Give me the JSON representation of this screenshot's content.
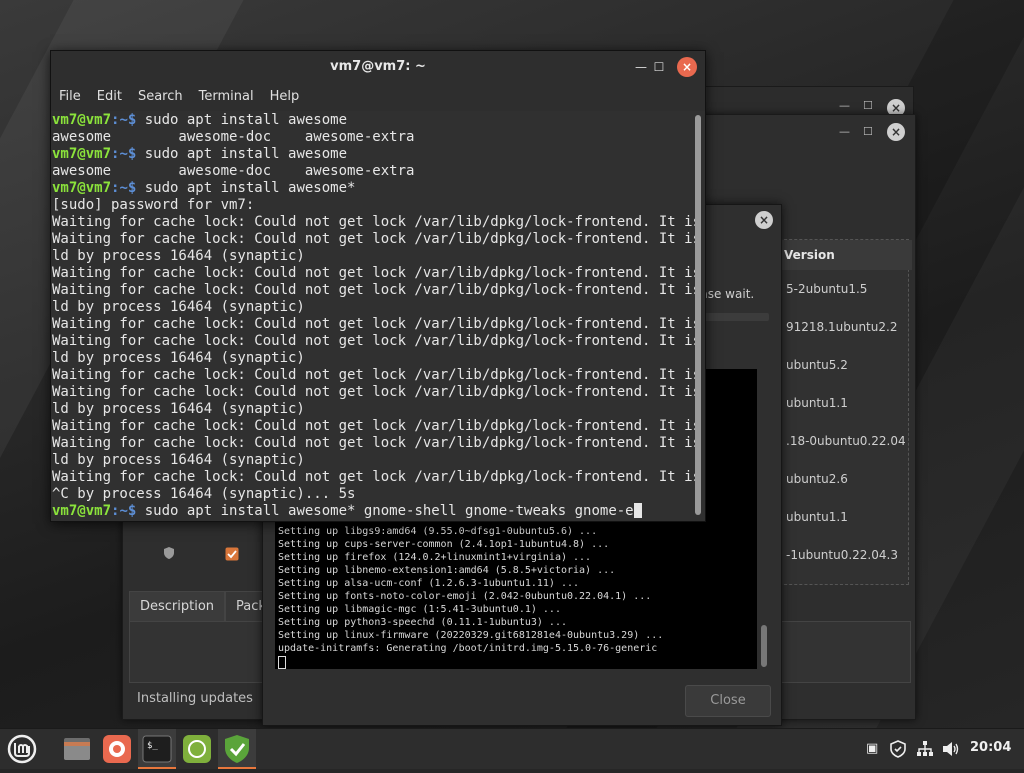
{
  "terminal": {
    "title": "vm7@vm7: ~",
    "menu": [
      "File",
      "Edit",
      "Search",
      "Terminal",
      "Help"
    ],
    "prompt_user": "vm7@vm7",
    "prompt_path": ":~$ ",
    "lines": [
      {
        "prompt": true,
        "text": "sudo apt install awesome"
      },
      {
        "prompt": false,
        "text": "awesome        awesome-doc    awesome-extra"
      },
      {
        "prompt": true,
        "text": "sudo apt install awesome"
      },
      {
        "prompt": false,
        "text": "awesome        awesome-doc    awesome-extra"
      },
      {
        "prompt": true,
        "text": "sudo apt install awesome*"
      },
      {
        "prompt": false,
        "text": "[sudo] password for vm7:"
      },
      {
        "prompt": false,
        "text": "Waiting for cache lock: Could not get lock /var/lib/dpkg/lock-frontend. It is he"
      },
      {
        "prompt": false,
        "text": "Waiting for cache lock: Could not get lock /var/lib/dpkg/lock-frontend. It is he"
      },
      {
        "prompt": false,
        "text": "ld by process 16464 (synaptic)"
      },
      {
        "prompt": false,
        "text": "Waiting for cache lock: Could not get lock /var/lib/dpkg/lock-frontend. It is he"
      },
      {
        "prompt": false,
        "text": "Waiting for cache lock: Could not get lock /var/lib/dpkg/lock-frontend. It is he"
      },
      {
        "prompt": false,
        "text": "ld by process 16464 (synaptic)"
      },
      {
        "prompt": false,
        "text": "Waiting for cache lock: Could not get lock /var/lib/dpkg/lock-frontend. It is he"
      },
      {
        "prompt": false,
        "text": "Waiting for cache lock: Could not get lock /var/lib/dpkg/lock-frontend. It is he"
      },
      {
        "prompt": false,
        "text": "ld by process 16464 (synaptic)"
      },
      {
        "prompt": false,
        "text": "Waiting for cache lock: Could not get lock /var/lib/dpkg/lock-frontend. It is he"
      },
      {
        "prompt": false,
        "text": "Waiting for cache lock: Could not get lock /var/lib/dpkg/lock-frontend. It is he"
      },
      {
        "prompt": false,
        "text": "ld by process 16464 (synaptic)"
      },
      {
        "prompt": false,
        "text": "Waiting for cache lock: Could not get lock /var/lib/dpkg/lock-frontend. It is he"
      },
      {
        "prompt": false,
        "text": "Waiting for cache lock: Could not get lock /var/lib/dpkg/lock-frontend. It is he"
      },
      {
        "prompt": false,
        "text": "ld by process 16464 (synaptic)"
      },
      {
        "prompt": false,
        "text": "Waiting for cache lock: Could not get lock /var/lib/dpkg/lock-frontend. It is he"
      },
      {
        "prompt": false,
        "text": "^C by process 16464 (synaptic)... 5s"
      },
      {
        "prompt": true,
        "text": "sudo apt install awesome* gnome-shell gnome-tweaks gnome-e",
        "cursor": true
      }
    ]
  },
  "update_manager": {
    "version_header": "Version",
    "versions": [
      "5-2ubuntu1.5",
      "91218.1ubuntu2.2",
      "ubuntu5.2",
      "ubuntu1.1",
      ".18-0ubuntu0.22.04",
      "ubuntu2.6",
      "ubuntu1.1",
      "-1ubuntu0.22.04.3"
    ],
    "tabs": [
      "Description",
      "Packa"
    ],
    "status": "Installing updates"
  },
  "install_dialog": {
    "partial_text": "ease wait.",
    "close_label": "Close",
    "log": [
      "Setting up libgs9:amd64 (9.55.0~dfsg1-0ubuntu5.6) ...",
      "Setting up cups-server-common (2.4.1op1-1ubuntu4.8) ...",
      "Setting up firefox (124.0.2+linuxmint1+virginia) ...",
      "Setting up libnemo-extension1:amd64 (5.8.5+victoria) ...",
      "Setting up alsa-ucm-conf (1.2.6.3-1ubuntu1.11) ...",
      "Setting up fonts-noto-color-emoji (2.042-0ubuntu0.22.04.1) ...",
      "Setting up libmagic-mgc (1:5.41-3ubuntu0.1) ...",
      "Setting up python3-speechd (0.11.1-1ubuntu3) ...",
      "Setting up linux-firmware (20220329.git681281e4-0ubuntu3.29) ...",
      "update-initramfs: Generating /boot/initrd.img-5.15.0-76-generic"
    ]
  },
  "taskbar": {
    "clock": "20:04",
    "apps": [
      {
        "name": "mint-menu-icon"
      },
      {
        "name": "files-icon"
      },
      {
        "name": "firefox-icon"
      },
      {
        "name": "terminal-icon",
        "active": true
      },
      {
        "name": "mintinstall-icon"
      },
      {
        "name": "update-manager-icon",
        "active": true
      }
    ]
  },
  "colors": {
    "prompt_user": "#8be33b",
    "prompt_path": "#5d8fd6",
    "close_button": "#e9694f",
    "accent": "#e8773c"
  }
}
